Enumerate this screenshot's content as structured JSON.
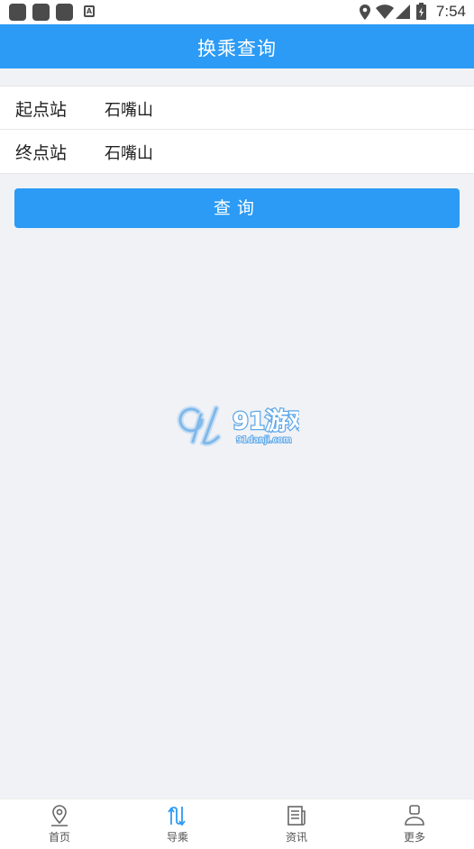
{
  "status_bar": {
    "time": "7:54"
  },
  "header": {
    "title": "换乘查询"
  },
  "form": {
    "start": {
      "label": "起点站",
      "value": "石嘴山"
    },
    "end": {
      "label": "终点站",
      "value": "石嘴山"
    }
  },
  "query_button": {
    "label": "查询"
  },
  "watermark": {
    "logo_text": "91游戏",
    "site": "91danji.com"
  },
  "bottom_nav": {
    "items": [
      {
        "label": "首页",
        "icon": "map-pin-icon"
      },
      {
        "label": "导乘",
        "icon": "route-arrows-icon"
      },
      {
        "label": "资讯",
        "icon": "news-icon"
      },
      {
        "label": "更多",
        "icon": "user-icon"
      }
    ]
  },
  "colors": {
    "primary": "#2b9bf5",
    "background": "#f1f2f6"
  }
}
